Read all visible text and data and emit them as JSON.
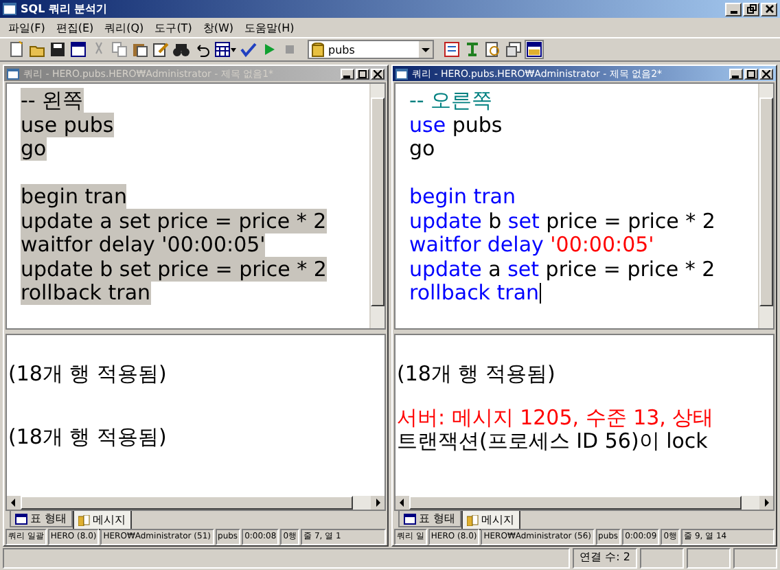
{
  "window": {
    "title": "SQL 쿼리 분석기"
  },
  "menu": [
    "파일(F)",
    "편집(E)",
    "쿼리(Q)",
    "도구(T)",
    "창(W)",
    "도움말(H)"
  ],
  "toolbar": {
    "database": "pubs"
  },
  "panes": [
    {
      "title": "쿼리 - HERO.pubs.HERO₩Administrator - 제목 없음1*",
      "active": false,
      "selected_text": true,
      "caret": false,
      "lines": [
        {
          "kind": "code",
          "segments": [
            {
              "text": "-- 왼쪽",
              "kind": "comment"
            }
          ]
        },
        {
          "kind": "code",
          "segments": [
            {
              "text": "use",
              "kind": "keyword"
            },
            {
              "text": " pubs",
              "kind": "plain"
            }
          ]
        },
        {
          "kind": "code",
          "segments": [
            {
              "text": "go",
              "kind": "plain"
            }
          ]
        },
        {
          "kind": "blank"
        },
        {
          "kind": "code",
          "segments": [
            {
              "text": "begin tran",
              "kind": "keyword"
            }
          ]
        },
        {
          "kind": "code",
          "segments": [
            {
              "text": "update",
              "kind": "keyword"
            },
            {
              "text": " a ",
              "kind": "plain"
            },
            {
              "text": "set",
              "kind": "keyword"
            },
            {
              "text": " price = price * 2",
              "kind": "plain"
            }
          ]
        },
        {
          "kind": "code",
          "segments": [
            {
              "text": "waitfor delay",
              "kind": "keyword"
            },
            {
              "text": " '00:00:05'",
              "kind": "string"
            }
          ]
        },
        {
          "kind": "code",
          "segments": [
            {
              "text": "update",
              "kind": "keyword"
            },
            {
              "text": " b ",
              "kind": "plain"
            },
            {
              "text": "set",
              "kind": "keyword"
            },
            {
              "text": " price = price * 2",
              "kind": "plain"
            }
          ]
        },
        {
          "kind": "code",
          "segments": [
            {
              "text": "rollback tran",
              "kind": "keyword"
            }
          ]
        }
      ],
      "messages": [
        {
          "kind": "info",
          "text": "(18개 행 적용됨)"
        },
        {
          "kind": "blank"
        },
        {
          "kind": "blank"
        },
        {
          "kind": "info",
          "text": "(18개 행 적용됨)"
        }
      ],
      "tabs": [
        {
          "label": "표 형태",
          "selected": false
        },
        {
          "label": "메시지",
          "selected": true
        }
      ],
      "status": [
        "쿼리 일괄",
        "HERO (8.0)",
        "HERO₩Administrator (51)",
        "pubs",
        "0:00:08",
        "0행",
        "줄 7, 열 1"
      ]
    },
    {
      "title": "쿼리 - HERO.pubs.HERO₩Administrator - 제목 없음2*",
      "active": true,
      "selected_text": false,
      "caret": true,
      "lines": [
        {
          "kind": "code",
          "segments": [
            {
              "text": "-- 오른쪽",
              "kind": "comment"
            }
          ]
        },
        {
          "kind": "code",
          "segments": [
            {
              "text": "use",
              "kind": "keyword"
            },
            {
              "text": " pubs",
              "kind": "plain"
            }
          ]
        },
        {
          "kind": "code",
          "segments": [
            {
              "text": "go",
              "kind": "plain"
            }
          ]
        },
        {
          "kind": "blank"
        },
        {
          "kind": "code",
          "segments": [
            {
              "text": "begin tran",
              "kind": "keyword"
            }
          ]
        },
        {
          "kind": "code",
          "segments": [
            {
              "text": "update",
              "kind": "keyword"
            },
            {
              "text": " b ",
              "kind": "plain"
            },
            {
              "text": "set",
              "kind": "keyword"
            },
            {
              "text": " price = price * 2",
              "kind": "plain"
            }
          ]
        },
        {
          "kind": "code",
          "segments": [
            {
              "text": "waitfor delay",
              "kind": "keyword"
            },
            {
              "text": " '00:00:05'",
              "kind": "string"
            }
          ]
        },
        {
          "kind": "code",
          "segments": [
            {
              "text": "update",
              "kind": "keyword"
            },
            {
              "text": " a ",
              "kind": "plain"
            },
            {
              "text": "set",
              "kind": "keyword"
            },
            {
              "text": " price = price * 2",
              "kind": "plain"
            }
          ]
        },
        {
          "kind": "code",
          "segments": [
            {
              "text": "rollback tran",
              "kind": "keyword"
            }
          ]
        }
      ],
      "messages": [
        {
          "kind": "info",
          "text": "(18개 행 적용됨)"
        },
        {
          "kind": "blank"
        },
        {
          "kind": "error",
          "text": "서버: 메시지 1205, 수준 13, 상태"
        },
        {
          "kind": "info",
          "text": "트랜잭션(프로세스 ID 56)이 lock"
        }
      ],
      "tabs": [
        {
          "label": "표 형태",
          "selected": false
        },
        {
          "label": "메시지",
          "selected": true
        }
      ],
      "status": [
        "쿼리 일",
        "HERO (8.0)",
        "HERO₩Administrator (56)",
        "pubs",
        "0:00:09",
        "0행",
        "줄 9, 열 14"
      ]
    }
  ],
  "status_bar": {
    "connections": "연결 수: 2"
  }
}
